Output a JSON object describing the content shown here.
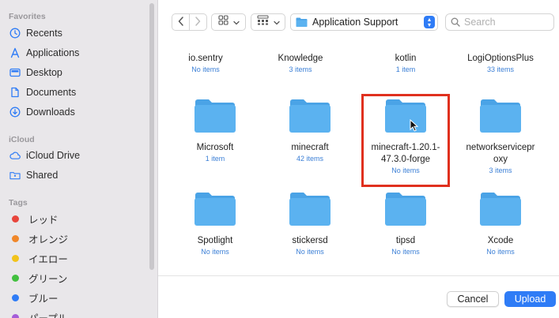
{
  "sidebar": {
    "favorites_heading": "Favorites",
    "favorites": [
      {
        "label": "Recents",
        "icon": "clock-icon"
      },
      {
        "label": "Applications",
        "icon": "applications-icon"
      },
      {
        "label": "Desktop",
        "icon": "desktop-icon"
      },
      {
        "label": "Documents",
        "icon": "document-icon"
      },
      {
        "label": "Downloads",
        "icon": "download-icon"
      }
    ],
    "icloud_heading": "iCloud",
    "icloud": [
      {
        "label": "iCloud Drive",
        "icon": "cloud-icon"
      },
      {
        "label": "Shared",
        "icon": "shared-folder-icon"
      }
    ],
    "tags_heading": "Tags",
    "tags": [
      {
        "label": "レッド",
        "color": "#e8453c"
      },
      {
        "label": "オレンジ",
        "color": "#f0872a"
      },
      {
        "label": "イエロー",
        "color": "#f2c31b"
      },
      {
        "label": "グリーン",
        "color": "#42c03f"
      },
      {
        "label": "ブルー",
        "color": "#2f7cf6"
      },
      {
        "label": "パープル",
        "color": "#a55cd8"
      }
    ]
  },
  "toolbar": {
    "back_icon": "chevron-left-icon",
    "forward_icon": "chevron-right-icon",
    "view_icon": "grid-view-icon",
    "group_icon": "group-view-icon",
    "location": "Application Support",
    "search_placeholder": "Search"
  },
  "items": [
    {
      "name": "io.sentry",
      "meta": "No items"
    },
    {
      "name": "Knowledge",
      "meta": "3 items"
    },
    {
      "name": "kotlin",
      "meta": "1 item"
    },
    {
      "name": "LogiOptionsPlus",
      "meta": "33 items"
    },
    {
      "name": "Microsoft",
      "meta": "1 item"
    },
    {
      "name": "minecraft",
      "meta": "42 items"
    },
    {
      "name": "minecraft-1.20.1-47.3.0-forge",
      "name_line1": "minecraft-1.20.1-",
      "name_line2": "47.3.0-forge",
      "meta": "No items"
    },
    {
      "name": "networkserviceproxy",
      "name_line1": "networkservicepr",
      "name_line2": "oxy",
      "meta": "3 items"
    },
    {
      "name": "Spotlight",
      "meta": "No items"
    },
    {
      "name": "stickersd",
      "meta": "No items"
    },
    {
      "name": "tipsd",
      "meta": "No items"
    },
    {
      "name": "Xcode",
      "meta": "No items"
    }
  ],
  "footer": {
    "cancel_label": "Cancel",
    "upload_label": "Upload"
  },
  "colors": {
    "accent": "#2f7cf6",
    "folder": "#5bb2f0",
    "folder_tab": "#4aa3e6",
    "highlight": "#e0301e"
  }
}
